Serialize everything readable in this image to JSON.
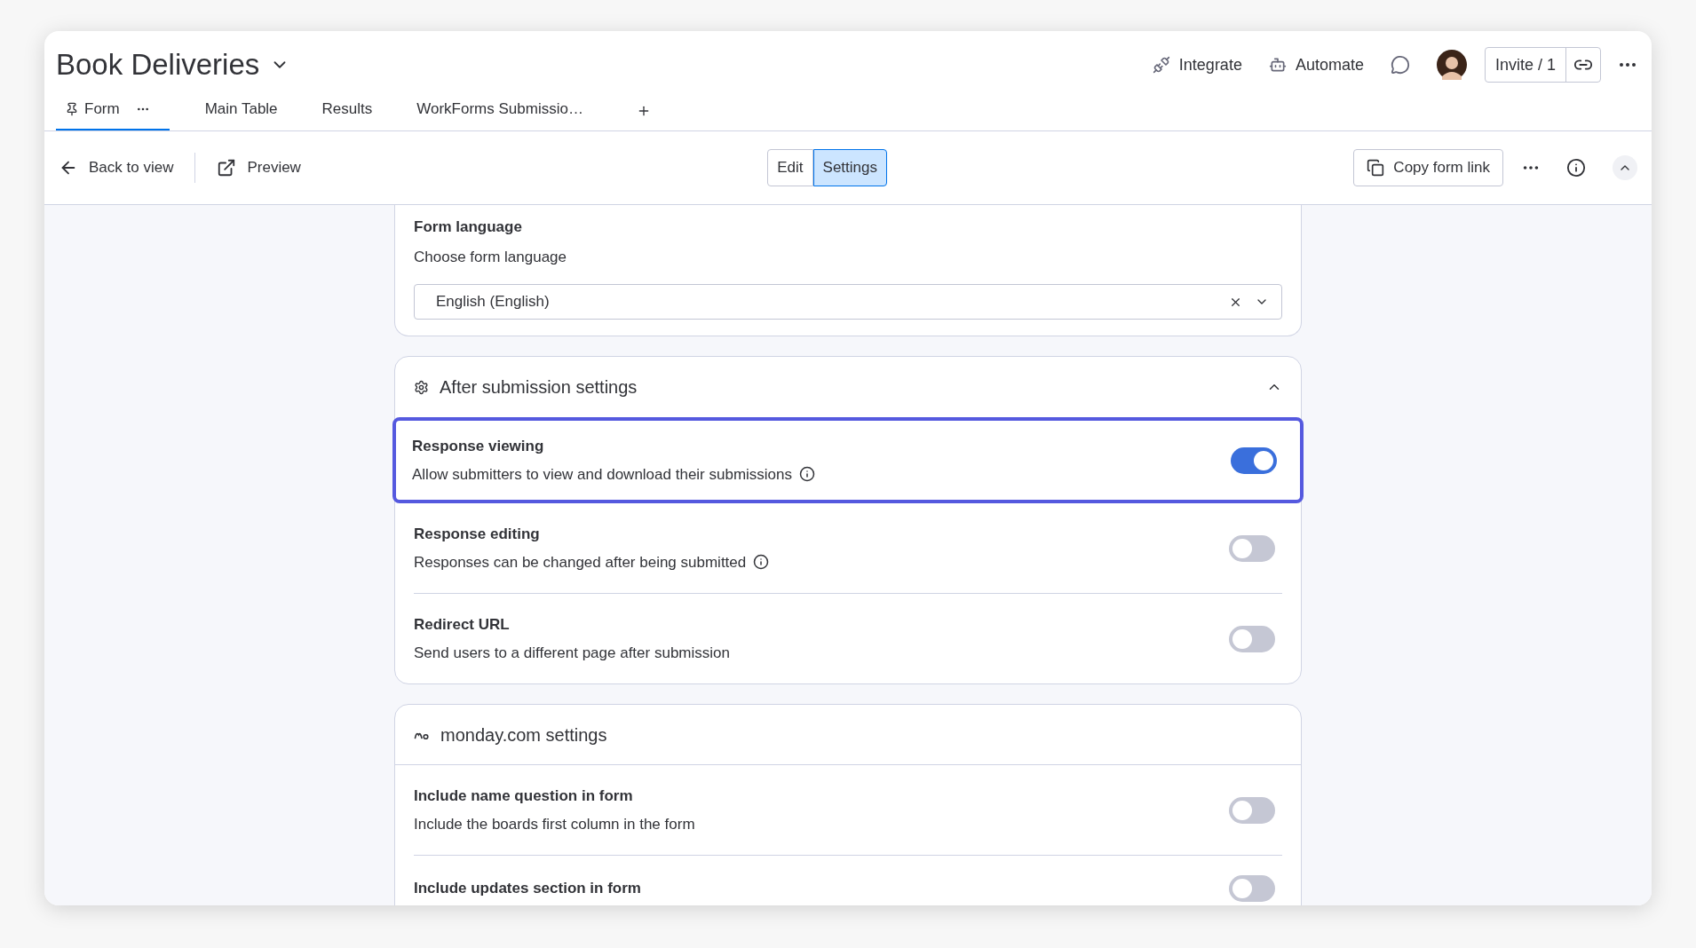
{
  "board": {
    "title": "Book Deliveries"
  },
  "header_actions": [
    {
      "kind": "integrate",
      "label": "Integrate"
    },
    {
      "kind": "automate",
      "label": "Automate"
    }
  ],
  "invite": {
    "label": "Invite / 1"
  },
  "tabs": [
    {
      "label": "Form",
      "selected": true
    },
    {
      "label": "Main Table",
      "selected": false
    },
    {
      "label": "Results",
      "selected": false
    },
    {
      "label": "WorkForms Submissio…",
      "selected": false
    }
  ],
  "toolbar": {
    "back": "Back to view",
    "preview": "Preview",
    "copy_link": "Copy form link"
  },
  "modes": [
    {
      "label": "Edit",
      "selected": false
    },
    {
      "label": "Settings",
      "selected": true
    }
  ],
  "sections": [
    {
      "kind": "language",
      "title": "Form language",
      "description": "Choose form language",
      "value": "English (English)"
    },
    {
      "kind": "after_submission",
      "title": "After submission settings",
      "expanded": true,
      "rows": [
        {
          "title": "Response viewing",
          "description": "Allow submitters to view and download their submissions",
          "info": true,
          "on": true,
          "highlighted": true
        },
        {
          "title": "Response editing",
          "description": "Responses can be changed after being submitted",
          "info": true,
          "on": false,
          "highlighted": false
        },
        {
          "title": "Redirect URL",
          "description": "Send users to a different page after submission",
          "info": false,
          "on": false,
          "highlighted": false
        }
      ]
    },
    {
      "kind": "monday",
      "title": "monday.com settings",
      "rows": [
        {
          "title": "Include name question in form",
          "description": "Include the boards first column in the form",
          "info": false,
          "on": false,
          "highlighted": false
        },
        {
          "title": "Include updates section in form",
          "info": false,
          "on": false,
          "highlighted": false
        }
      ]
    }
  ]
}
